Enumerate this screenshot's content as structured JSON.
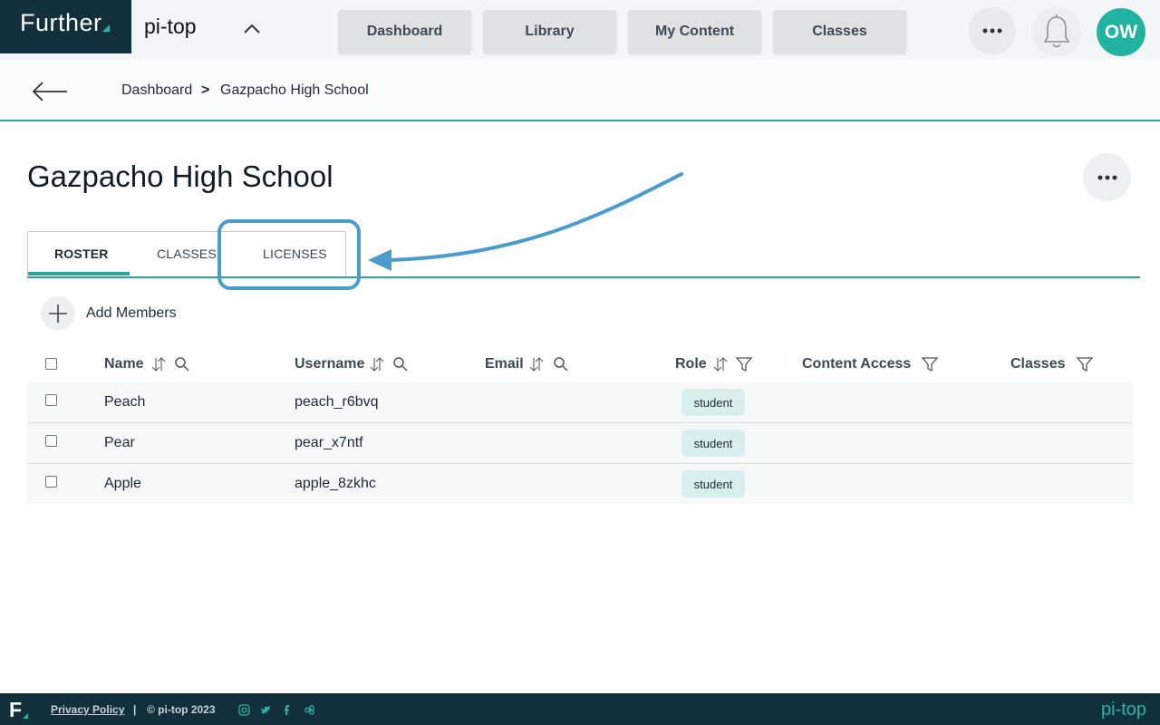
{
  "brand": {
    "name": "Further",
    "org": "pi-top"
  },
  "nav": {
    "dashboard": "Dashboard",
    "library": "Library",
    "my_content": "My Content",
    "classes": "Classes"
  },
  "user": {
    "initials": "OW"
  },
  "breadcrumb": {
    "root": "Dashboard",
    "separator": ">",
    "current": "Gazpacho High School"
  },
  "page": {
    "title": "Gazpacho High School"
  },
  "tabs": [
    {
      "label": "ROSTER",
      "active": true
    },
    {
      "label": "CLASSES",
      "active": false
    },
    {
      "label": "LICENSES",
      "active": false
    }
  ],
  "roster": {
    "add_label": "Add Members",
    "columns": {
      "name": "Name",
      "username": "Username",
      "email": "Email",
      "role": "Role",
      "content_access": "Content Access",
      "classes": "Classes"
    },
    "rows": [
      {
        "name": "Peach",
        "username": "peach_r6bvq",
        "email": "",
        "role": "student"
      },
      {
        "name": "Pear",
        "username": "pear_x7ntf",
        "email": "",
        "role": "student"
      },
      {
        "name": "Apple",
        "username": "apple_8zkhc",
        "email": "",
        "role": "student"
      }
    ]
  },
  "footer": {
    "privacy": "Privacy Policy",
    "separator": "|",
    "copyright": "© pi-top 2023",
    "logo": "pi-top",
    "mark": "F"
  },
  "colors": {
    "brand_dark": "#12303c",
    "accent": "#2aa79a",
    "avatar": "#22b3a0",
    "annotation": "#4a9ccd",
    "badge": "#d7efed"
  },
  "icons": [
    "chevron-up-icon",
    "ellipsis-icon",
    "bell-icon",
    "back-arrow-icon",
    "plus-icon",
    "sort-icon",
    "search-icon",
    "filter-icon",
    "instagram-icon",
    "twitter-icon",
    "facebook-icon",
    "pi-top-icon"
  ]
}
